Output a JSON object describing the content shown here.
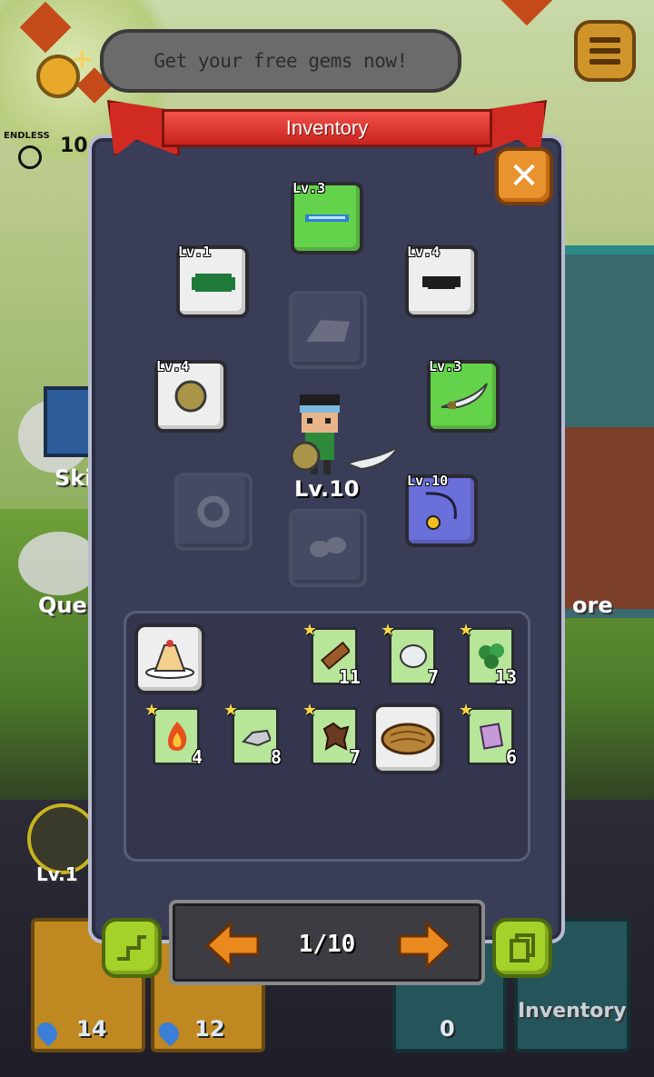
{
  "hud": {
    "free_gems_text": "Get your free gems now!",
    "endless_label": "ENDLESS",
    "endless_value": "10"
  },
  "inventory": {
    "title": "Inventory",
    "equipment": {
      "top": {
        "level": "Lv.3",
        "rarity": "green",
        "item": "blade"
      },
      "upper_left": {
        "level": "Lv.1",
        "rarity": "white",
        "item": "green-armor"
      },
      "upper_right": {
        "level": "Lv.4",
        "rarity": "white",
        "item": "mask"
      },
      "mid_left": {
        "level": "Lv.4",
        "rarity": "white",
        "item": "wooden-shield"
      },
      "mid_right": {
        "level": "Lv.3",
        "rarity": "green",
        "item": "scimitar"
      },
      "lower_right": {
        "level": "Lv.10",
        "rarity": "blue",
        "item": "amulet"
      }
    },
    "hero_level": "Lv.10",
    "bag_items": [
      {
        "name": "pudding",
        "count": ""
      },
      {
        "name": "log",
        "count": "11"
      },
      {
        "name": "stone",
        "count": "7"
      },
      {
        "name": "herb",
        "count": "13"
      },
      {
        "name": "fire",
        "count": "4"
      },
      {
        "name": "iron-ore",
        "count": "8"
      },
      {
        "name": "leather",
        "count": "7"
      },
      {
        "name": "bread",
        "count": ""
      },
      {
        "name": "cloth",
        "count": "6"
      }
    ],
    "page": "1/10"
  },
  "background": {
    "skills_label": "Ski",
    "quest_label": "Ques",
    "store_label": "ore",
    "hero_level": "Lv.1",
    "gem_count_1": "14",
    "gem_count_2": "12",
    "count_3": "0",
    "inventory_label": "Inventory"
  },
  "colors": {
    "panel": "#3a3d57",
    "ribbon": "#d12a22",
    "close": "#e9932f",
    "green_btn": "#a5d22a",
    "rarity_white": "#eeeeee",
    "rarity_green": "#64d24a",
    "rarity_blue": "#6a6fd9"
  }
}
